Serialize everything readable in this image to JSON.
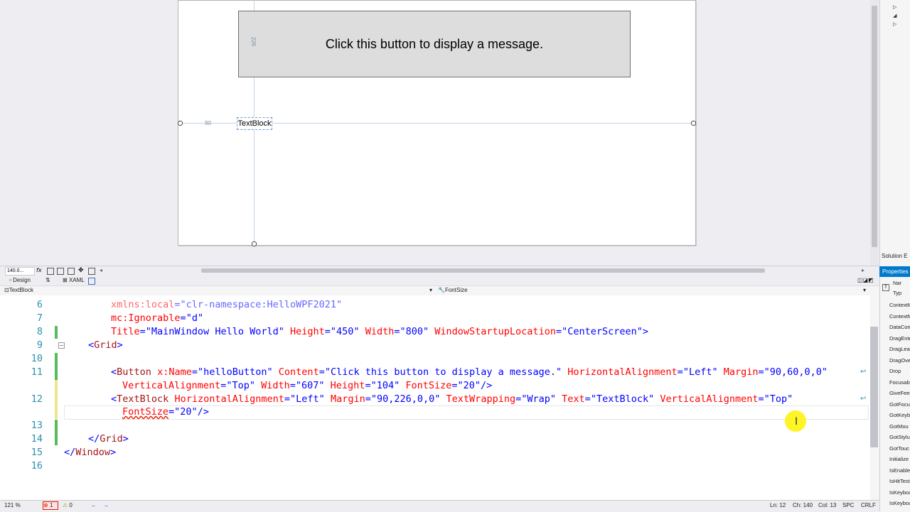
{
  "designer": {
    "button_content": "Click this button to display a message.",
    "textblock_text": "TextBlock",
    "margin_top_label": "226",
    "margin_left_label": "90"
  },
  "toolbar": {
    "zoom": "140.0...",
    "fx": "fx"
  },
  "tabs": {
    "design": "Design",
    "swap": "⇅",
    "xaml": "XAML"
  },
  "nav": {
    "left": "TextBlock",
    "right": "FontSize"
  },
  "right_panel": {
    "solution_tab": "Solution E",
    "properties_title": "Properties",
    "name_label": "Nar",
    "type_label": "Typ",
    "events": [
      "ContextM",
      "ContextM",
      "DataCon",
      "DragEnte",
      "DragLeav",
      "DragOve",
      "Drop",
      "Focusab",
      "GiveFeed",
      "GotFocu",
      "GotKeyb",
      "GotMou",
      "GotStylu",
      "GotTouc",
      "Initialize",
      "IsEnable",
      "IsHitTest",
      "IsKeyboa",
      "IsKeyboa"
    ]
  },
  "code": {
    "line_numbers": [
      "6",
      "7",
      "8",
      "9",
      "10",
      "11",
      "",
      "12",
      "",
      "13",
      "14",
      "15",
      "16"
    ],
    "l6_attr": "xmlns:local",
    "l6_eq": "=",
    "l6_val": "\"clr-namespace:HelloWPF2021\"",
    "l7_attr": "mc:Ignorable",
    "l7_eq": "=",
    "l7_val": "\"d\"",
    "l8_a1": "Title",
    "l8_v1": "\"MainWindow Hello World\"",
    "l8_a2": "Height",
    "l8_v2": "\"450\"",
    "l8_a3": "Width",
    "l8_v3": "\"800\"",
    "l8_a4": "WindowStartupLocation",
    "l8_v4": "\"CenterScreen\"",
    "l8_end": ">",
    "l9_open": "<",
    "l9_tag": "Grid",
    "l9_close": ">",
    "l11_open": "<",
    "l11_tag": "Button",
    "l11_a1": "x:Name",
    "l11_v1": "\"helloButton\"",
    "l11_a2": "Content",
    "l11_v2": "\"Click this button to display a message.\"",
    "l11_a3": "HorizontalAlignment",
    "l11_v3": "\"Left\"",
    "l11_a4": "Margin",
    "l11_v4": "\"90,60,0,0\"",
    "l11b_a1": "VerticalAlignment",
    "l11b_v1": "\"Top\"",
    "l11b_a2": "Width",
    "l11b_v2": "\"607\"",
    "l11b_a3": "Height",
    "l11b_v3": "\"104\"",
    "l11b_a4": "FontSize",
    "l11b_v4": "\"20\"",
    "l11b_end": "/>",
    "l12_open": "<",
    "l12_tag": "TextBlock",
    "l12_a1": "HorizontalAlignment",
    "l12_v1": "\"Left\"",
    "l12_a2": "Margin",
    "l12_v2": "\"90,226,0,0\"",
    "l12_a3": "TextWrapping",
    "l12_v3": "\"Wrap\"",
    "l12_a4": "Text",
    "l12_v4": "\"TextBlock\"",
    "l12_a5": "VerticalAlignment",
    "l12_v5": "\"Top\"",
    "l12b_a1": "FontSize",
    "l12b_v1": "\"20\"",
    "l12b_end": "/>",
    "l14_open": "</",
    "l14_tag": "Grid",
    "l14_close": ">",
    "l15_open": "</",
    "l15_tag": "Window",
    "l15_close": ">"
  },
  "status": {
    "zoom": "121 %",
    "errors": "1",
    "warnings": "0",
    "ln": "Ln: 12",
    "ch": "Ch: 140",
    "col": "Col: 13",
    "spc": "SPC",
    "crlf": "CRLF"
  }
}
